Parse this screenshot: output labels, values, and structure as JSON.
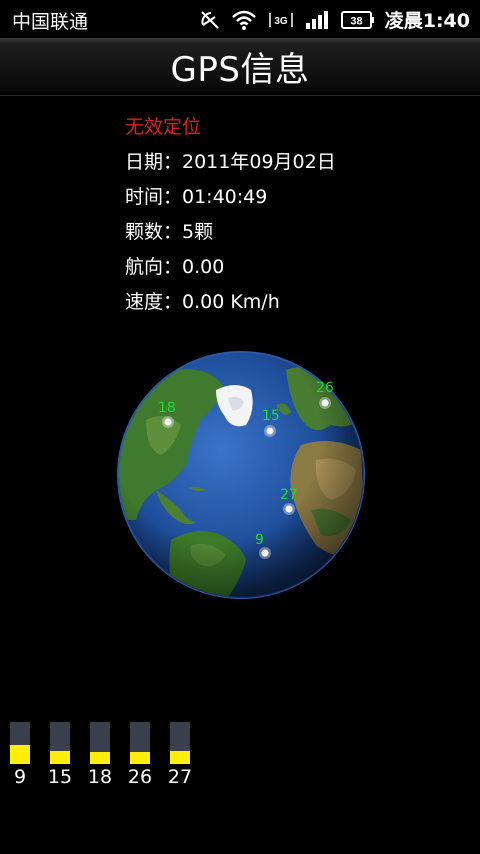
{
  "status_bar": {
    "carrier": "中国联通",
    "time": "凌晨1:40",
    "icons": [
      "gps-off-icon",
      "wifi-icon",
      "3g-data-icon",
      "cell-signal-icon",
      "battery-icon"
    ],
    "battery_level": "38",
    "network_type": "3G"
  },
  "title": "GPS信息",
  "info": {
    "status": "无效定位",
    "date_label": "日期：2011年09月02日",
    "time_label": "时间：01:40:49",
    "count_label": "颗数：5颗",
    "heading_label": "航向：0.00",
    "speed_label": "速度：0.00 Km/h"
  },
  "globe_satellites": [
    {
      "id": "18"
    },
    {
      "id": "15"
    },
    {
      "id": "26"
    },
    {
      "id": "27"
    },
    {
      "id": "9"
    }
  ],
  "signal_bars": [
    {
      "id": "9",
      "level": 0.45
    },
    {
      "id": "15",
      "level": 0.3
    },
    {
      "id": "18",
      "level": 0.28
    },
    {
      "id": "26",
      "level": 0.28
    },
    {
      "id": "27",
      "level": 0.3
    }
  ],
  "colors": {
    "invalid_status": "#e01e1e",
    "satellite_label": "#22dd22",
    "bar_fill": "#ffef00",
    "bar_track": "#3b3f4c"
  }
}
